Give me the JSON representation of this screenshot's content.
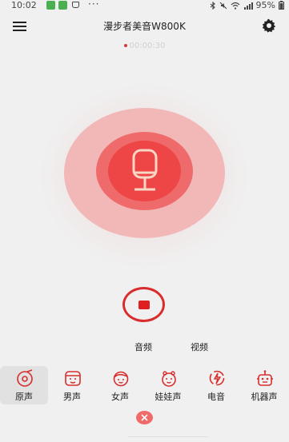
{
  "status": {
    "time": "10:02",
    "battery": "95%"
  },
  "header": {
    "title": "漫步者美音W800K"
  },
  "timer": {
    "value": "00:00:30"
  },
  "modes": [
    {
      "label": "音频"
    },
    {
      "label": "视频"
    }
  ],
  "voices": [
    {
      "label": "原声",
      "icon": "vinyl-icon",
      "active": true
    },
    {
      "label": "男声",
      "icon": "man-face-icon",
      "active": false
    },
    {
      "label": "女声",
      "icon": "woman-face-icon",
      "active": false
    },
    {
      "label": "娃娃声",
      "icon": "baby-face-icon",
      "active": false
    },
    {
      "label": "电音",
      "icon": "electric-icon",
      "active": false
    },
    {
      "label": "机器声",
      "icon": "robot-icon",
      "active": false
    }
  ],
  "colors": {
    "accent": "#e02020",
    "ring_outer": "#f2b8b8",
    "ring_mid": "#ef6b6b",
    "ring_inner": "#ee4646",
    "icon_red": "#d92d2d"
  }
}
